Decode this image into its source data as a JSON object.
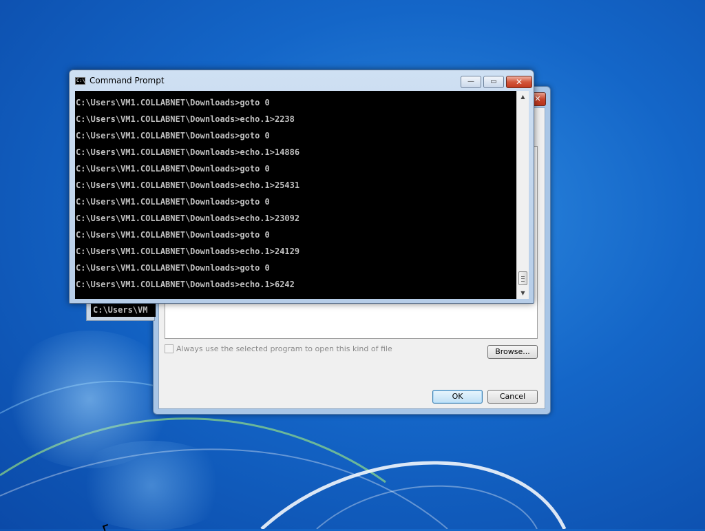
{
  "cmd_window": {
    "title": "Command Prompt",
    "icon_text": "C:\\",
    "min_glyph": "—",
    "max_glyph": "▭",
    "close_glyph": "✕",
    "lines": [
      "C:\\Users\\VM1.COLLABNET\\Downloads>goto 0",
      "C:\\Users\\VM1.COLLABNET\\Downloads>echo.1>2238",
      "C:\\Users\\VM1.COLLABNET\\Downloads>goto 0",
      "C:\\Users\\VM1.COLLABNET\\Downloads>echo.1>14886",
      "C:\\Users\\VM1.COLLABNET\\Downloads>goto 0",
      "C:\\Users\\VM1.COLLABNET\\Downloads>echo.1>25431",
      "C:\\Users\\VM1.COLLABNET\\Downloads>goto 0",
      "C:\\Users\\VM1.COLLABNET\\Downloads>echo.1>23092",
      "C:\\Users\\VM1.COLLABNET\\Downloads>goto 0",
      "C:\\Users\\VM1.COLLABNET\\Downloads>echo.1>24129",
      "C:\\Users\\VM1.COLLABNET\\Downloads>goto 0",
      "C:\\Users\\VM1.COLLABNET\\Downloads>echo.1>6242"
    ],
    "scroll_up_glyph": "▲",
    "scroll_down_glyph": "▼"
  },
  "console_fragment": {
    "text": "C:\\Users\\VM"
  },
  "open_with_dialog": {
    "close_glyph": "✕",
    "always_use_label": "Always use the selected program to open this kind of file",
    "browse_label": "Browse...",
    "ok_label": "OK",
    "cancel_label": "Cancel"
  },
  "colors": {
    "desktop": "#1466c8",
    "console_bg": "#000000",
    "console_text": "#c0c0c0"
  }
}
